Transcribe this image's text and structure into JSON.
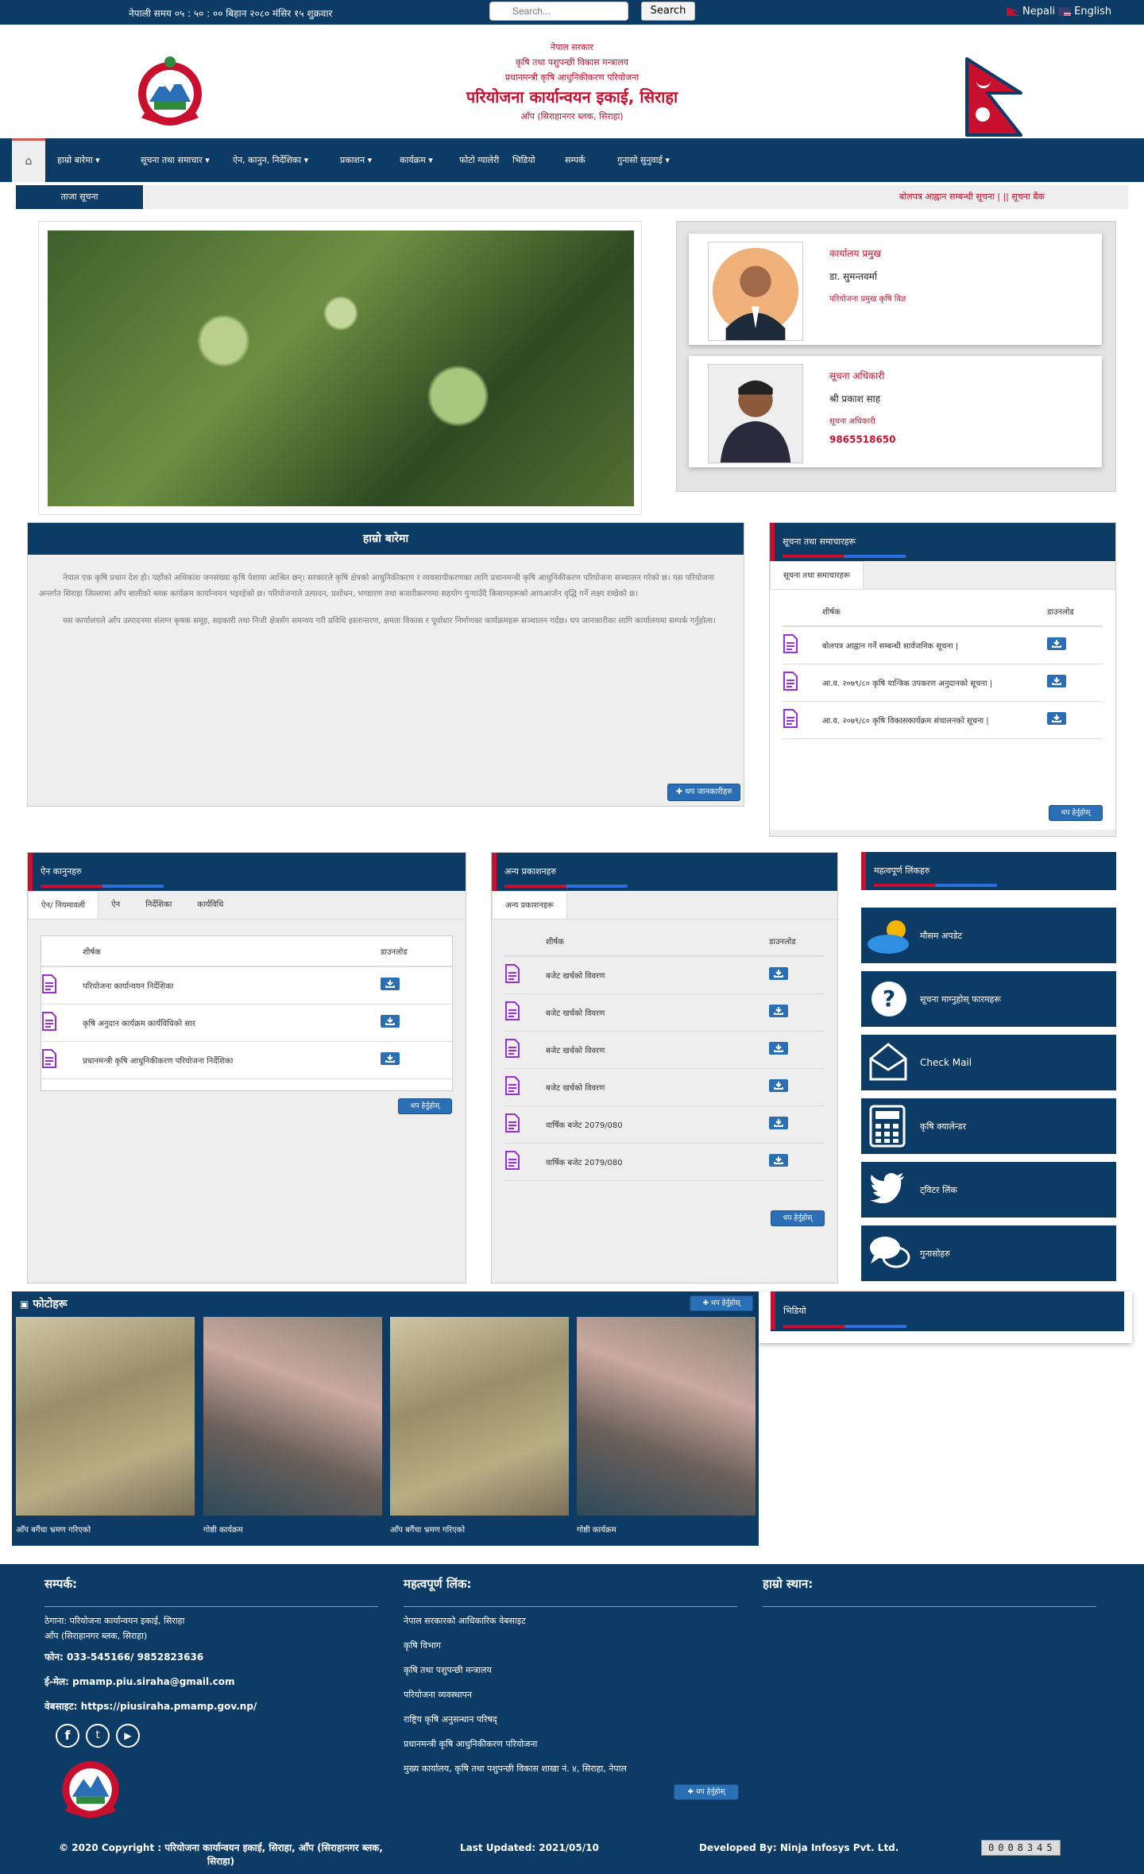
{
  "topbar": {
    "clock": "नेपाली समय ०५ : ५० : ०० बिहान   २०८० मंसिर १५ शुक्रवार",
    "search_placeholder": "Search...",
    "search_button": "Search",
    "lang_nepali": "Nepali",
    "lang_english": "English"
  },
  "header": {
    "line1": "नेपाल सरकार",
    "line2": "कृषि तथा पशुपन्छी विकास मन्त्रालय",
    "line3": "प्रधानमन्त्री कृषि आधुनिकीकरण परियोजना",
    "title": "परियोजना कार्यान्वयन इकाई, सिराहा",
    "subtitle": "आँप (सिराहानगर ब्लक, सिराहा)"
  },
  "nav": {
    "items": [
      "हाम्रो बारेमा",
      "सूचना तथा समाचार",
      "ऐन, कानुन, निर्देशिका",
      "प्रकाशन",
      "कार्यक्रम",
      "फोटो ग्यालेरी",
      "भिडियो",
      "सम्पर्क",
      "गुनासो सुनुवाई"
    ]
  },
  "ticker": {
    "label": "ताजा सूचना",
    "text": "बोलपत्र आह्वान सम्बन्धी सूचना | ||  सूचना बैंक"
  },
  "people": [
    {
      "role": "कार्यालय प्रमुख",
      "name": "डा. सुमन्तवर्मा",
      "title": "परियोजना प्रमुख कृषि विज्ञ",
      "phone": ""
    },
    {
      "role": "सूचना अधिकारी",
      "name": "श्री प्रकाश साह",
      "title": "सूचना अधिकारी",
      "phone": "9865518650"
    }
  ],
  "about": {
    "heading": "हाम्रो बारेमा",
    "para1": "नेपाल एक कृषि प्रधान देश हो। यहाँको अधिकांश जनसंख्या कृषि पेशामा आश्रित छन्। सरकारले कृषि क्षेत्रको आधुनिकीकरण र व्यवसायीकरणका लागि प्रधानमन्त्री कृषि आधुनिकीकरण परियोजना सञ्चालन गरेको छ। यस परियोजना अन्तर्गत सिराहा जिल्लामा आँप बालीको ब्लक कार्यक्रम कार्यान्वयन भइरहेको छ। परियोजनाले उत्पादन, प्रशोधन, भण्डारण तथा बजारीकरणमा सहयोग पुर्‍याउँदै किसानहरूको आयआर्जन वृद्धि गर्ने लक्ष्य राखेको छ।",
    "para2": "यस कार्यालयले आँप उत्पादनमा संलग्न कृषक समूह, सहकारी तथा निजी क्षेत्रसँग समन्वय गरी प्रविधि हस्तान्तरण, क्षमता विकास र पूर्वाधार निर्माणका कार्यक्रमहरू सञ्चालन गर्दछ। थप जानकारीका लागि कार्यालयमा सम्पर्क गर्नुहोला।",
    "more": "थप जानकारीहरु"
  },
  "latest_notice": {
    "heading": "सूचना तथा समाचारहरू",
    "tab": "सूचना तथा समाचारहरू",
    "col_title": "शीर्षक",
    "col_dl": "डाउनलोड",
    "rows": [
      "बोलपत्र आह्वान गर्ने सम्बन्धी सार्वजनिक सूचना |",
      "आ.व. २०७९/८० कृषि यान्त्रिक उपकरण अनुदानको सूचना |",
      "आ.व. २०७९/८० कृषि विकासकार्यक्रम संचालनको सूचना |"
    ],
    "more": "थप हेर्नुहोस्"
  },
  "acts": {
    "heading": "ऐन कानुनहरु",
    "tabs": [
      "ऐन/ नियमावली",
      "ऐन",
      "निर्देशिका",
      "कार्यविधि"
    ],
    "col_title": "शीर्षक",
    "col_dl": "डाउनलोड",
    "rows": [
      "परियोजना कार्यान्वयन निर्देशिका",
      "कृषि अनुदान कार्यक्रम कार्यविधिको सार",
      "प्रधानमन्त्री कृषि आधुनिकीकरण परियोजना निर्देशिका"
    ],
    "more": "थप हेर्नुहोस्"
  },
  "publications": {
    "heading": "अन्य प्रकाशनहरु",
    "tab": "अन्य प्रकाशनहरू",
    "col_title": "शीर्षक",
    "col_dl": "डाउनलोड",
    "rows": [
      "बजेट खर्चको विवरण",
      "बजेट खर्चको विवरण",
      "बजेट खर्चको विवरण",
      "बजेट खर्चको विवरण",
      "वार्षिक बजेट 2079/080",
      "वार्षिक बजेट 2079/080"
    ],
    "more": "थप हेर्नुहोस्"
  },
  "quicklinks": {
    "heading": "महत्वपूर्ण लिंकहरु",
    "items": [
      "मौसम अपडेट",
      "सूचना माग्नुहोस् फारमहरू",
      "Check Mail",
      "कृषि क्यालेन्डर",
      "ट्विटर लिंक",
      "गुनासोहरु"
    ]
  },
  "video": {
    "heading": "भिडियो"
  },
  "gallery": {
    "heading": "फोटोहरू",
    "more": "थप हेर्नुहोस्",
    "captions": [
      "आँप बगैंचा भ्रमण गरिएको",
      "गोष्ठी कार्यक्रम",
      "आँप बगैंचा भ्रमण गरिएको",
      "गोष्ठी कार्यक्रम"
    ]
  },
  "footer": {
    "contact_heading": "सम्पर्क:",
    "address_line1": "ठेगाना: परियोजना कार्यान्वयन इकाई, सिराहा",
    "address_line2": "आँप (सिराहानगर ब्लक, सिराहा)",
    "phone": "फोन: 033-545166/ 9852823636",
    "email": "ई-मेल: pmamp.piu.siraha@gmail.com",
    "website": "वेबसाइट: https://piusiraha.pmamp.gov.np/",
    "links_heading": "महत्वपूर्ण लिंक:",
    "links": [
      "नेपाल सरकारको आधिकारिक वेबसाइट",
      "कृषि विभाग",
      "कृषि तथा पशुपन्छी मन्त्रालय",
      "परियोजना व्यवस्थापन",
      "राष्ट्रिय कृषि अनुसन्धान परिषद्",
      "प्रधानमन्त्री कृषि आधुनिकीकरण परियोजना",
      "मुख्य कार्यालय, कृषि तथा पशुपन्छी विकास शाखा नं. ४, सिराहा, नेपाल"
    ],
    "links_more": "थप हेर्नुहोस्",
    "map_heading": "हाम्रो स्थान:",
    "copyright": "© 2020 Copyright : परियोजना कार्यान्वयन इकाई, सिराहा, आँप (सिराहानगर ब्लक, सिराहा)",
    "updated": "Last Updated: 2021/05/10",
    "developer": "Developed By: Ninja Infosys Pvt. Ltd.",
    "counter": "0008345"
  },
  "colors": {
    "navy": "#0c3b66",
    "red": "#c8102e",
    "btn": "#2a6fb5"
  }
}
